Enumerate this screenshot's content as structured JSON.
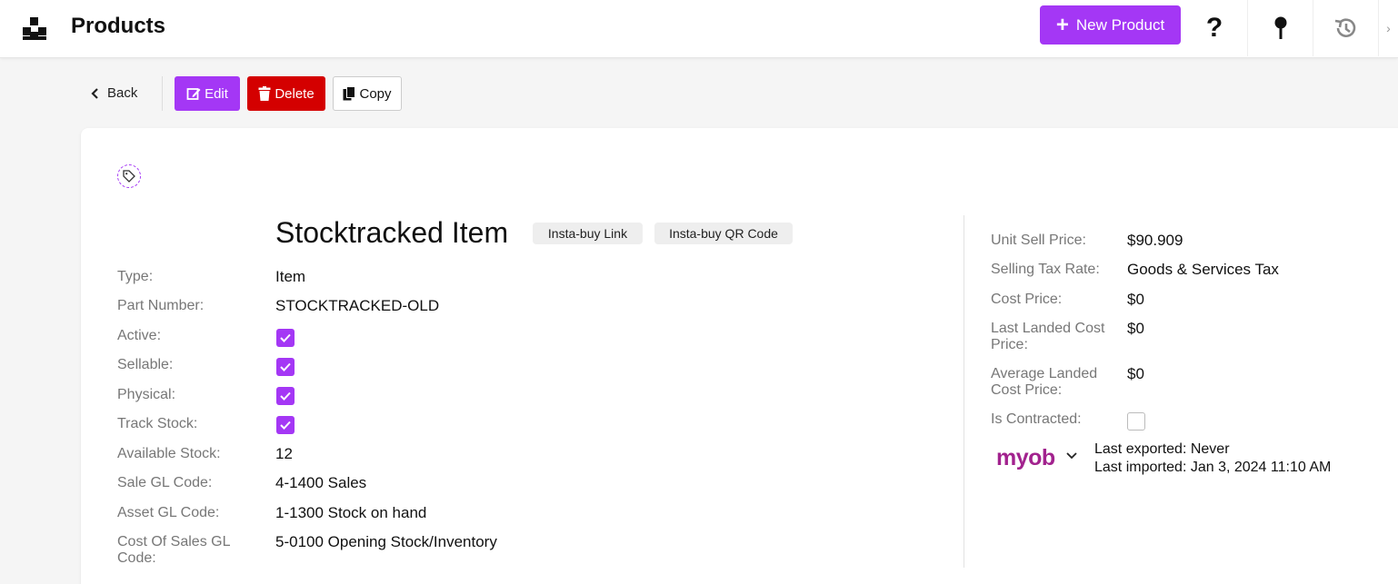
{
  "header": {
    "title": "Products",
    "new_product_label": "New Product",
    "accent_color": "#a437f5"
  },
  "toolbar": {
    "back_label": "Back",
    "edit_label": "Edit",
    "delete_label": "Delete",
    "copy_label": "Copy"
  },
  "product": {
    "title": "Stocktracked Item",
    "insta_buy_link_label": "Insta-buy Link",
    "insta_buy_qr_label": "Insta-buy QR Code",
    "fields": {
      "type": {
        "label": "Type:",
        "value": "Item"
      },
      "part_number": {
        "label": "Part Number:",
        "value": "STOCKTRACKED-OLD"
      },
      "active": {
        "label": "Active:",
        "checked": true
      },
      "sellable": {
        "label": "Sellable:",
        "checked": true
      },
      "physical": {
        "label": "Physical:",
        "checked": true
      },
      "track_stock": {
        "label": "Track Stock:",
        "checked": true
      },
      "available_stock": {
        "label": "Available Stock:",
        "value": "12"
      },
      "sale_gl_code": {
        "label": "Sale GL Code:",
        "value": "4-1400 Sales"
      },
      "asset_gl_code": {
        "label": "Asset GL Code:",
        "value": "1-1300 Stock on hand"
      },
      "cost_of_sales_gl_code": {
        "label_line1": "Cost Of Sales GL",
        "label_line2": "Code:",
        "value": "5-0100 Opening Stock/Inventory"
      }
    },
    "pricing": {
      "unit_sell_price": {
        "label": "Unit Sell Price:",
        "value": "$90.909"
      },
      "selling_tax_rate": {
        "label": "Selling Tax Rate:",
        "value": "Goods & Services Tax"
      },
      "cost_price": {
        "label": "Cost Price:",
        "value": "$0"
      },
      "last_landed_cost_price": {
        "label_line1": "Last Landed Cost",
        "label_line2": "Price:",
        "value": "$0"
      },
      "average_landed_cost_price": {
        "label_line1": "Average Landed",
        "label_line2": "Cost Price:",
        "value": "$0"
      },
      "is_contracted": {
        "label": "Is Contracted:",
        "checked": false
      }
    },
    "integration": {
      "name": "myob",
      "last_exported": "Last exported: Never",
      "last_imported": "Last imported: Jan 3, 2024 11:10 AM"
    }
  }
}
